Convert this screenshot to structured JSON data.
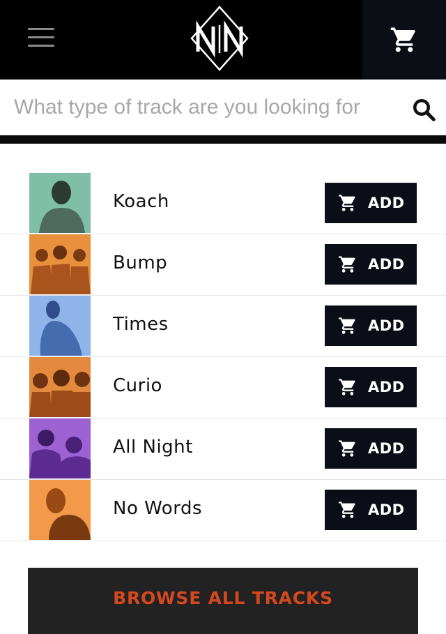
{
  "colors": {
    "header_bg": "#000000",
    "cart_box_bg": "#0b0e14",
    "add_button_bg": "#0b0e16",
    "browse_button_bg": "#222222",
    "browse_text": "#d4481f"
  },
  "header": {
    "menu_icon": "hamburger-menu-icon",
    "logo_icon": "nm-diamond-logo",
    "cart_icon": "shopping-cart-icon"
  },
  "search": {
    "placeholder": "What type of track are you looking for",
    "value": "",
    "icon": "search-icon"
  },
  "tracks": [
    {
      "title": "Koach",
      "add_label": "ADD",
      "thumb_color": "#7fbfa8"
    },
    {
      "title": "Bump",
      "add_label": "ADD",
      "thumb_color": "#e8903c"
    },
    {
      "title": "Times",
      "add_label": "ADD",
      "thumb_color": "#8fb4ea"
    },
    {
      "title": "Curio",
      "add_label": "ADD",
      "thumb_color": "#e38a3e"
    },
    {
      "title": "All Night",
      "add_label": "ADD",
      "thumb_color": "#9c62d2"
    },
    {
      "title": "No Words",
      "add_label": "ADD",
      "thumb_color": "#f29a4a"
    }
  ],
  "browse": {
    "label": "BROWSE ALL TRACKS"
  }
}
